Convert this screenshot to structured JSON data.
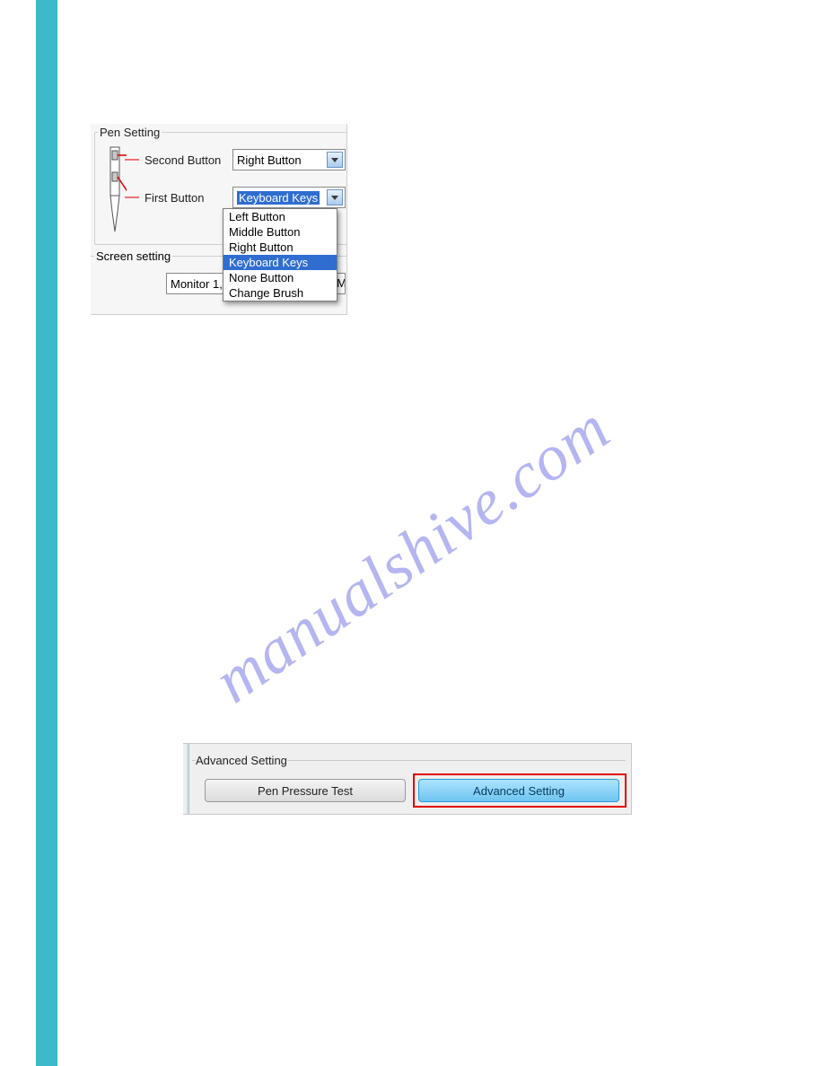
{
  "watermark": "manualshive.com",
  "pen_panel": {
    "title": "Pen Setting",
    "second_button_label": "Second Button",
    "first_button_label": "First Button",
    "second_button_value": "Right Button",
    "first_button_value": "Keyboard Keys",
    "dropdown_options": [
      "Left Button",
      "Middle Button",
      "Right Button",
      "Keyboard Keys",
      "None Button",
      "Change Brush"
    ],
    "dropdown_selected": "Keyboard Keys",
    "screen_setting_label": "Screen setting",
    "monitor_value": "Monitor 1,W"
  },
  "advanced_panel": {
    "title": "Advanced Setting",
    "btn_pressure": "Pen Pressure Test",
    "btn_advanced": "Advanced Setting"
  }
}
